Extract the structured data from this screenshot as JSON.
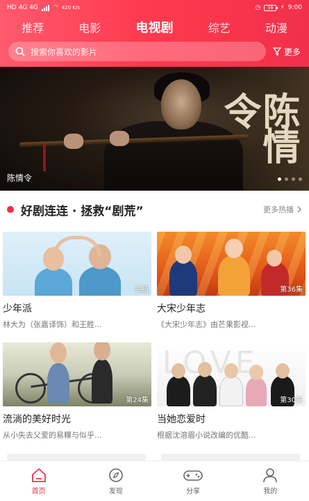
{
  "status_bar": {
    "network_left": "HD 4G 4G",
    "speed": "420 K/s",
    "battery": "58",
    "time": "9:00"
  },
  "tabs": [
    {
      "label": "推荐",
      "active": false
    },
    {
      "label": "电影",
      "active": false
    },
    {
      "label": "电视剧",
      "active": true
    },
    {
      "label": "综艺",
      "active": false
    },
    {
      "label": "动漫",
      "active": false
    }
  ],
  "search": {
    "placeholder": "搜索你喜欢的影片",
    "filter_label": "更多"
  },
  "banner": {
    "title": "陈情令",
    "calligraphy": "陈情令",
    "slide_count": 4,
    "active_slide": 1
  },
  "section": {
    "title": "好剧连连 · 拯救“剧荒”",
    "more": "更多热播"
  },
  "cards": [
    {
      "title": "少年派",
      "desc": "林大为（张嘉译饰）和王胜...",
      "badge": "完结"
    },
    {
      "title": "大宋少年志",
      "desc": "《大宋少年志》由芒果影视...",
      "badge": "第36集"
    },
    {
      "title": "流淌的美好时光",
      "desc": "从小失去父爱的易粿与似乎...",
      "badge": "第24集"
    },
    {
      "title": "当她恋爱时",
      "desc": "根据沈溶眉小说改编的优酷...",
      "badge": "第30集"
    }
  ],
  "bottom_nav": [
    {
      "label": "首页",
      "icon": "home-icon",
      "active": true
    },
    {
      "label": "发现",
      "icon": "compass-icon",
      "active": false
    },
    {
      "label": "分享",
      "icon": "gamepad-icon",
      "active": false
    },
    {
      "label": "我的",
      "icon": "person-icon",
      "active": false
    }
  ],
  "colors": {
    "accent": "#f2304a",
    "header_start": "#ff5a6e",
    "header_end": "#f2304a"
  }
}
